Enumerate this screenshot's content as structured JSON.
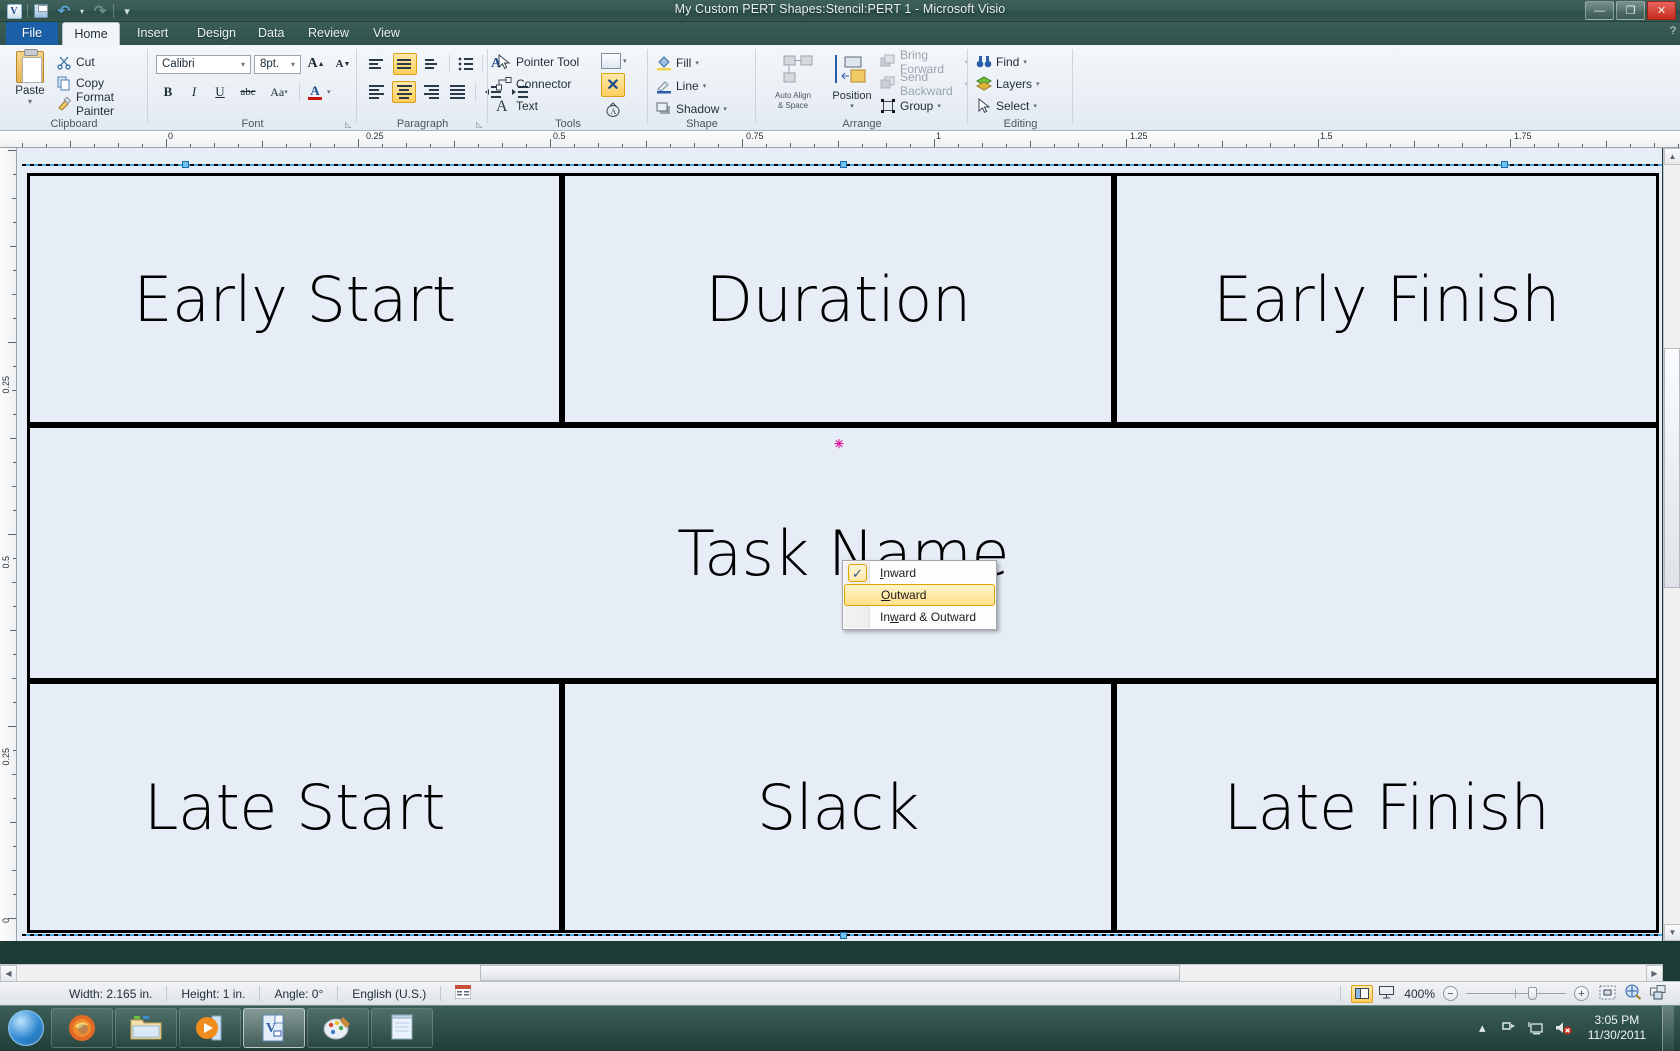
{
  "window": {
    "title": "My Custom PERT Shapes:Stencil:PERT 1  -  Microsoft Visio",
    "minimize": "—",
    "restore": "❐",
    "close": "✕"
  },
  "quick_access": {
    "logo": "V",
    "save": "save-icon",
    "undo": "↶",
    "undo_arrow": "▾",
    "redo": "↷",
    "customize": "▾"
  },
  "tabs": [
    {
      "label": "File",
      "active": false,
      "file": true
    },
    {
      "label": "Home",
      "active": true
    },
    {
      "label": "Insert",
      "active": false
    },
    {
      "label": "Design",
      "active": false
    },
    {
      "label": "Data",
      "active": false
    },
    {
      "label": "Review",
      "active": false
    },
    {
      "label": "View",
      "active": false
    }
  ],
  "ribbon": {
    "groups": [
      {
        "name": "Clipboard"
      },
      {
        "name": "Font"
      },
      {
        "name": "Paragraph"
      },
      {
        "name": "Tools"
      },
      {
        "name": "Shape"
      },
      {
        "name": "Arrange"
      },
      {
        "name": "Editing"
      }
    ],
    "clipboard": {
      "paste": "Paste",
      "paste_arrow": "▾",
      "cut": "Cut",
      "copy": "Copy",
      "format_painter": "Format Painter"
    },
    "font": {
      "family": "Calibri",
      "size": "8pt.",
      "grow": "A",
      "shrink": "A",
      "bold": "B",
      "italic": "I",
      "underline": "U",
      "strikethrough": "abc",
      "change_case": "Aa",
      "change_case_arrow": "▾",
      "font_color": "A",
      "font_color_arrow": "▾"
    },
    "paragraph": {
      "bullets": "bullet-list-icon",
      "text_direction": "A",
      "align_left": "align-left-icon",
      "align_center": "align-center-icon",
      "align_right": "align-right-icon",
      "justify": "justify-icon",
      "decrease_indent": "decrease-indent-icon",
      "increase_indent": "increase-indent-icon"
    },
    "tools": {
      "pointer_tool": "Pointer Tool",
      "connector": "Connector",
      "text": "Text",
      "rect_arrow": "▾"
    },
    "shape": {
      "fill": "Fill",
      "line": "Line",
      "shadow": "Shadow",
      "arrow": "▾"
    },
    "arrange": {
      "auto_align": "Auto Align",
      "auto_align_2": "& Space",
      "position": "Position",
      "position_arrow": "▾",
      "bring_forward": "Bring Forward",
      "send_backward": "Send Backward",
      "group": "Group",
      "arrow": "▾"
    },
    "editing": {
      "find": "Find",
      "layers": "Layers",
      "select": "Select",
      "arrow": "▾"
    }
  },
  "rulers": {
    "horizontal_labels": [
      "0",
      "0.25",
      "0.5",
      "0.75",
      "1",
      "1.25",
      "1.5",
      "1.75"
    ],
    "vertical_labels": [
      "0.25",
      "0.5",
      "0.25",
      "0"
    ]
  },
  "canvas": {
    "cells": [
      {
        "label": "Early Start"
      },
      {
        "label": "Duration"
      },
      {
        "label": "Early Finish"
      },
      {
        "label": "Task Name"
      },
      {
        "label": "Late Start"
      },
      {
        "label": "Slack"
      },
      {
        "label": "Late Finish"
      }
    ]
  },
  "context_menu": {
    "items": [
      {
        "label": "Inward",
        "underline_index": 1,
        "checked": true,
        "selected": false
      },
      {
        "label": "Outward",
        "underline_index": 1,
        "checked": false,
        "selected": true
      },
      {
        "label": "Inward & Outward",
        "underline_index": 3,
        "checked": false,
        "selected": false
      }
    ],
    "check_glyph": "✓"
  },
  "status_bar": {
    "width": "Width: 2.165 in.",
    "height": "Height: 1 in.",
    "angle": "Angle: 0°",
    "language": "English (U.S.)",
    "macro_icon": "macro-record-icon",
    "zoom_level": "400%",
    "zoom_out": "−",
    "zoom_in": "+",
    "view_normal": "normal-view-icon",
    "view_full": "fullscreen-view-icon",
    "fit_page": "fit-page-icon",
    "pan_zoom": "pan-zoom-icon",
    "window_arrange": "window-arrange-icon"
  },
  "taskbar": {
    "start": "windows-start-orb",
    "buttons": [
      {
        "name": "firefox",
        "active": false
      },
      {
        "name": "windows-explorer",
        "active": false
      },
      {
        "name": "media-player",
        "active": false
      },
      {
        "name": "visio",
        "active": true
      },
      {
        "name": "paint",
        "active": false
      },
      {
        "name": "notepad",
        "active": false
      }
    ],
    "tray": {
      "expand": "▴",
      "network": "network-icon",
      "display": "display-icon",
      "volume": "volume-muted-icon",
      "time": "3:05 PM",
      "date": "11/30/2011"
    }
  },
  "colors": {
    "accent": "#1a5fa8",
    "titlebar": "#37554f",
    "canvas_bg": "#e6edf7",
    "menu_highlight": "#ffe08a",
    "selection": "#6fc2f0"
  }
}
